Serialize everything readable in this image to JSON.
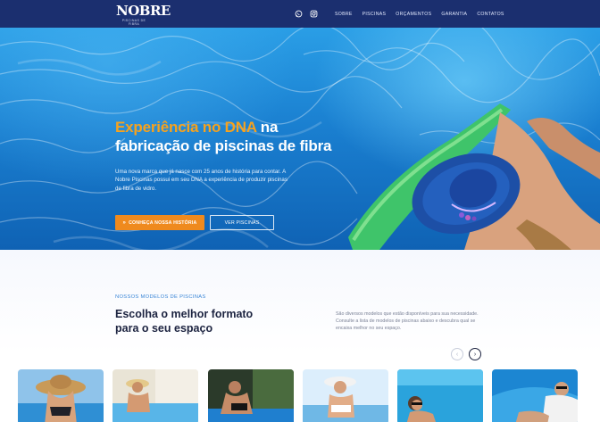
{
  "header": {
    "logo_text": "NOBRE",
    "logo_subtext": "PISCINAS DE FIBRA",
    "icons": [
      "whatsapp-icon",
      "instagram-icon"
    ],
    "nav": [
      "SOBRE",
      "PISCINAS",
      "ORÇAMENTOS",
      "GARANTIA",
      "CONTATOS"
    ]
  },
  "hero": {
    "title_accent": "Experiência no DNA",
    "title_rest_1": " na",
    "title_line_2": "fabricação de piscinas de fibra",
    "text": "Uma nova marca que já nasce com 25 anos de história para contar. A Nobre Piscinas possui em seu DNA a experiência de produzir piscinas de fibra de vidro.",
    "primary_button": "CONHEÇA NOSSA HISTÓRIA",
    "secondary_button": "VER PISCINAS"
  },
  "models": {
    "eyebrow": "NOSSOS MODELOS DE PISCINAS",
    "title_line_1": "Escolha o melhor formato",
    "title_line_2": "para o seu espaço",
    "description": "São diversos modelos que estão disponíveis para sua necessidade. Consulte a lista de modelos de piscinas abaixo e descubra qual se encaixa melhor no seu espaço.",
    "prev_arrow": "‹",
    "next_arrow": "›",
    "card_count": 6
  },
  "colors": {
    "header_bg": "#1b2f6f",
    "accent_orange": "#ef8a1e",
    "title_accent": "#f6a21e",
    "eyebrow_blue": "#3a86d6",
    "dark_text": "#1c2340"
  }
}
